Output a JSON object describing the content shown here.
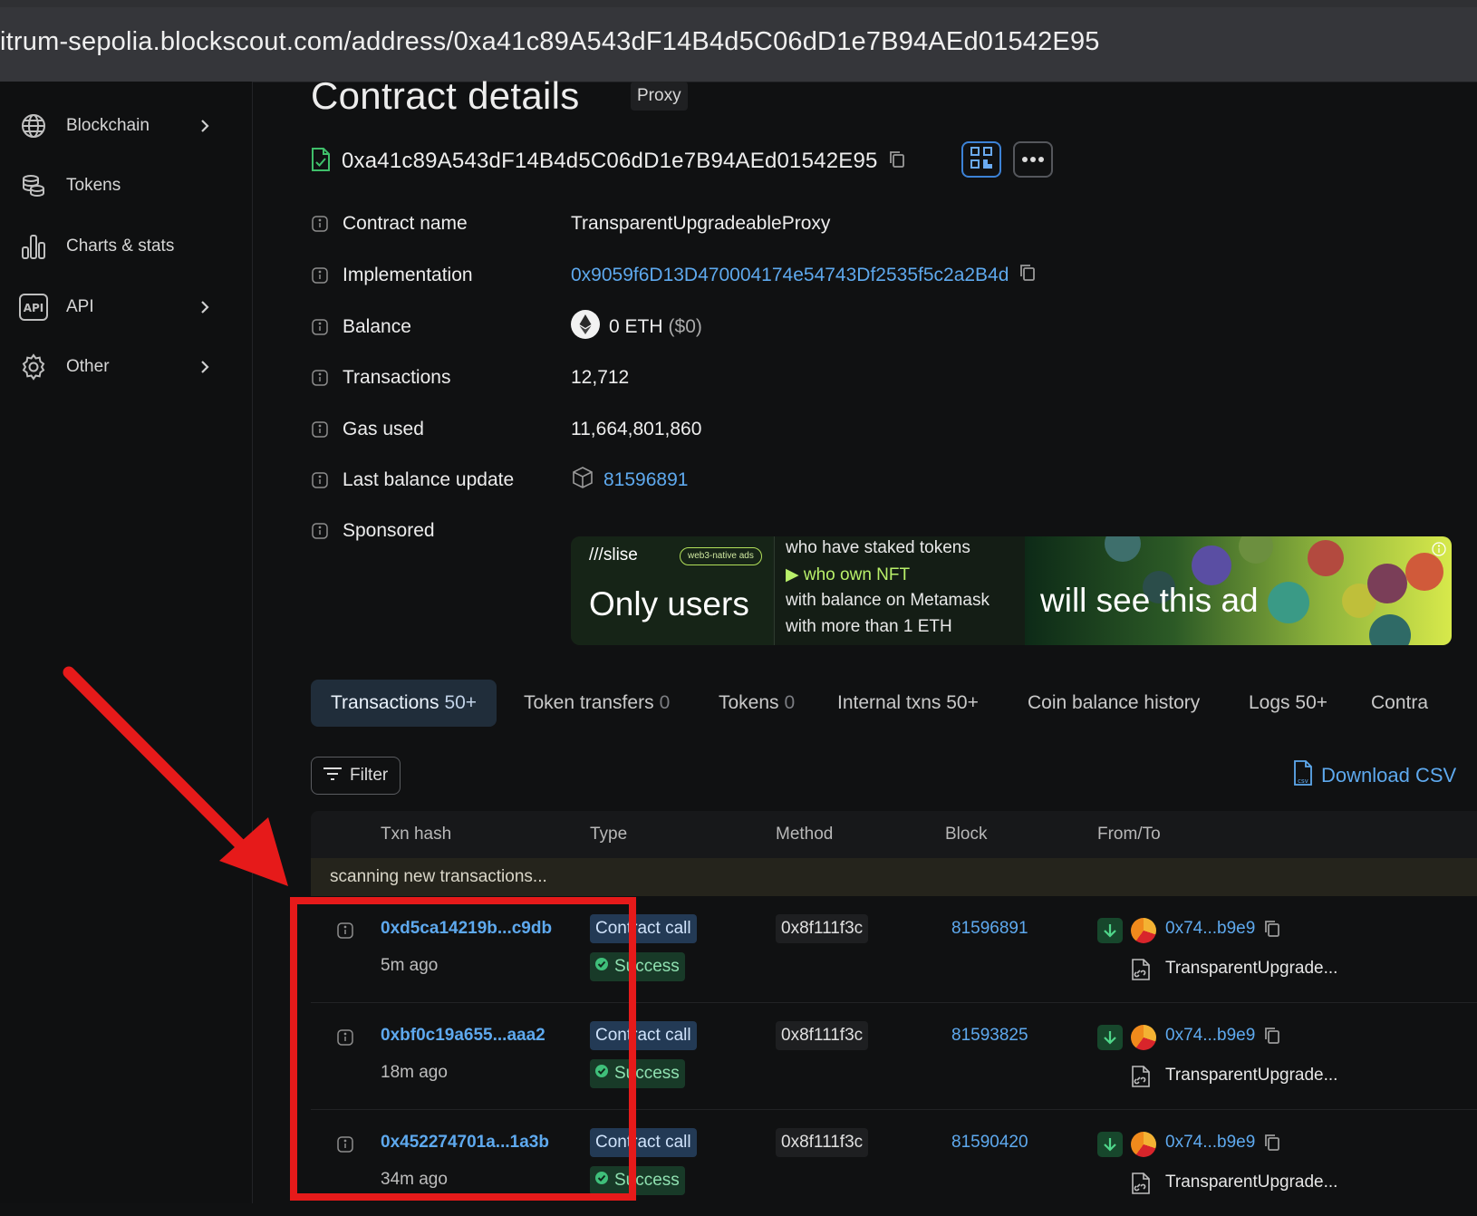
{
  "browser": {
    "url": "itrum-sepolia.blockscout.com/address/0xa41c89A543dF14B4d5C06dD1e7B94AEd01542E95"
  },
  "sidebar": {
    "items": [
      {
        "label": "Blockchain",
        "icon": "globe-icon",
        "has_chevron": true
      },
      {
        "label": "Tokens",
        "icon": "coins-icon",
        "has_chevron": false
      },
      {
        "label": "Charts & stats",
        "icon": "bar-chart-icon",
        "has_chevron": false
      },
      {
        "label": "API",
        "icon": "api-icon",
        "has_chevron": true
      },
      {
        "label": "Other",
        "icon": "gear-icon",
        "has_chevron": true
      }
    ]
  },
  "page": {
    "title": "Contract details",
    "badge": "Proxy",
    "address": "0xa41c89A543dF14B4d5C06dD1e7B94AEd01542E95"
  },
  "details": {
    "contract_name": {
      "label": "Contract name",
      "value": "TransparentUpgradeableProxy"
    },
    "implementation": {
      "label": "Implementation",
      "value": "0x9059f6D13D470004174e54743Df2535f5c2a2B4d"
    },
    "balance": {
      "label": "Balance",
      "value": "0 ETH",
      "usd": "($0)"
    },
    "transactions": {
      "label": "Transactions",
      "value": "12,712"
    },
    "gas_used": {
      "label": "Gas used",
      "value": "11,664,801,860"
    },
    "last_balance_update": {
      "label": "Last balance update",
      "value": "81596891"
    },
    "sponsored": {
      "label": "Sponsored"
    }
  },
  "ad": {
    "logo": "slise",
    "tag": "web3-native ads",
    "headline": "Only users",
    "lines": [
      "who have staked tokens",
      "who own NFT",
      "with balance on Metamask",
      "with more than 1 ETH"
    ],
    "tagline": "will see this ad"
  },
  "tabs": [
    {
      "label": "Transactions",
      "count": "50+",
      "active": true
    },
    {
      "label": "Token transfers",
      "count": "0"
    },
    {
      "label": "Tokens",
      "count": "0"
    },
    {
      "label": "Internal txns",
      "count": "50+"
    },
    {
      "label": "Coin balance history",
      "count": ""
    },
    {
      "label": "Logs",
      "count": "50+"
    },
    {
      "label": "Contra",
      "count": ""
    }
  ],
  "toolbar": {
    "filter_label": "Filter",
    "download_label": "Download CSV"
  },
  "table": {
    "headers": [
      "Txn hash",
      "Type",
      "Method",
      "Block",
      "From/To"
    ],
    "scanning": "scanning new transactions...",
    "rows": [
      {
        "hash": "0xd5ca14219b...c9db",
        "age": "5m ago",
        "type": "Contract call",
        "status": "Success",
        "method": "0x8f111f3c",
        "block": "81596891",
        "from": "0x74...b9e9",
        "to": "TransparentUpgrade..."
      },
      {
        "hash": "0xbf0c19a655...aaa2",
        "age": "18m ago",
        "type": "Contract call",
        "status": "Success",
        "method": "0x8f111f3c",
        "block": "81593825",
        "from": "0x74...b9e9",
        "to": "TransparentUpgrade..."
      },
      {
        "hash": "0x452274701a...1a3b",
        "age": "34m ago",
        "type": "Contract call",
        "status": "Success",
        "method": "0x8f111f3c",
        "block": "81590420",
        "from": "0x74...b9e9",
        "to": "TransparentUpgrade..."
      }
    ]
  },
  "colors": {
    "link": "#5ea9ee",
    "annotation": "#e61a1a",
    "background": "#101112"
  }
}
